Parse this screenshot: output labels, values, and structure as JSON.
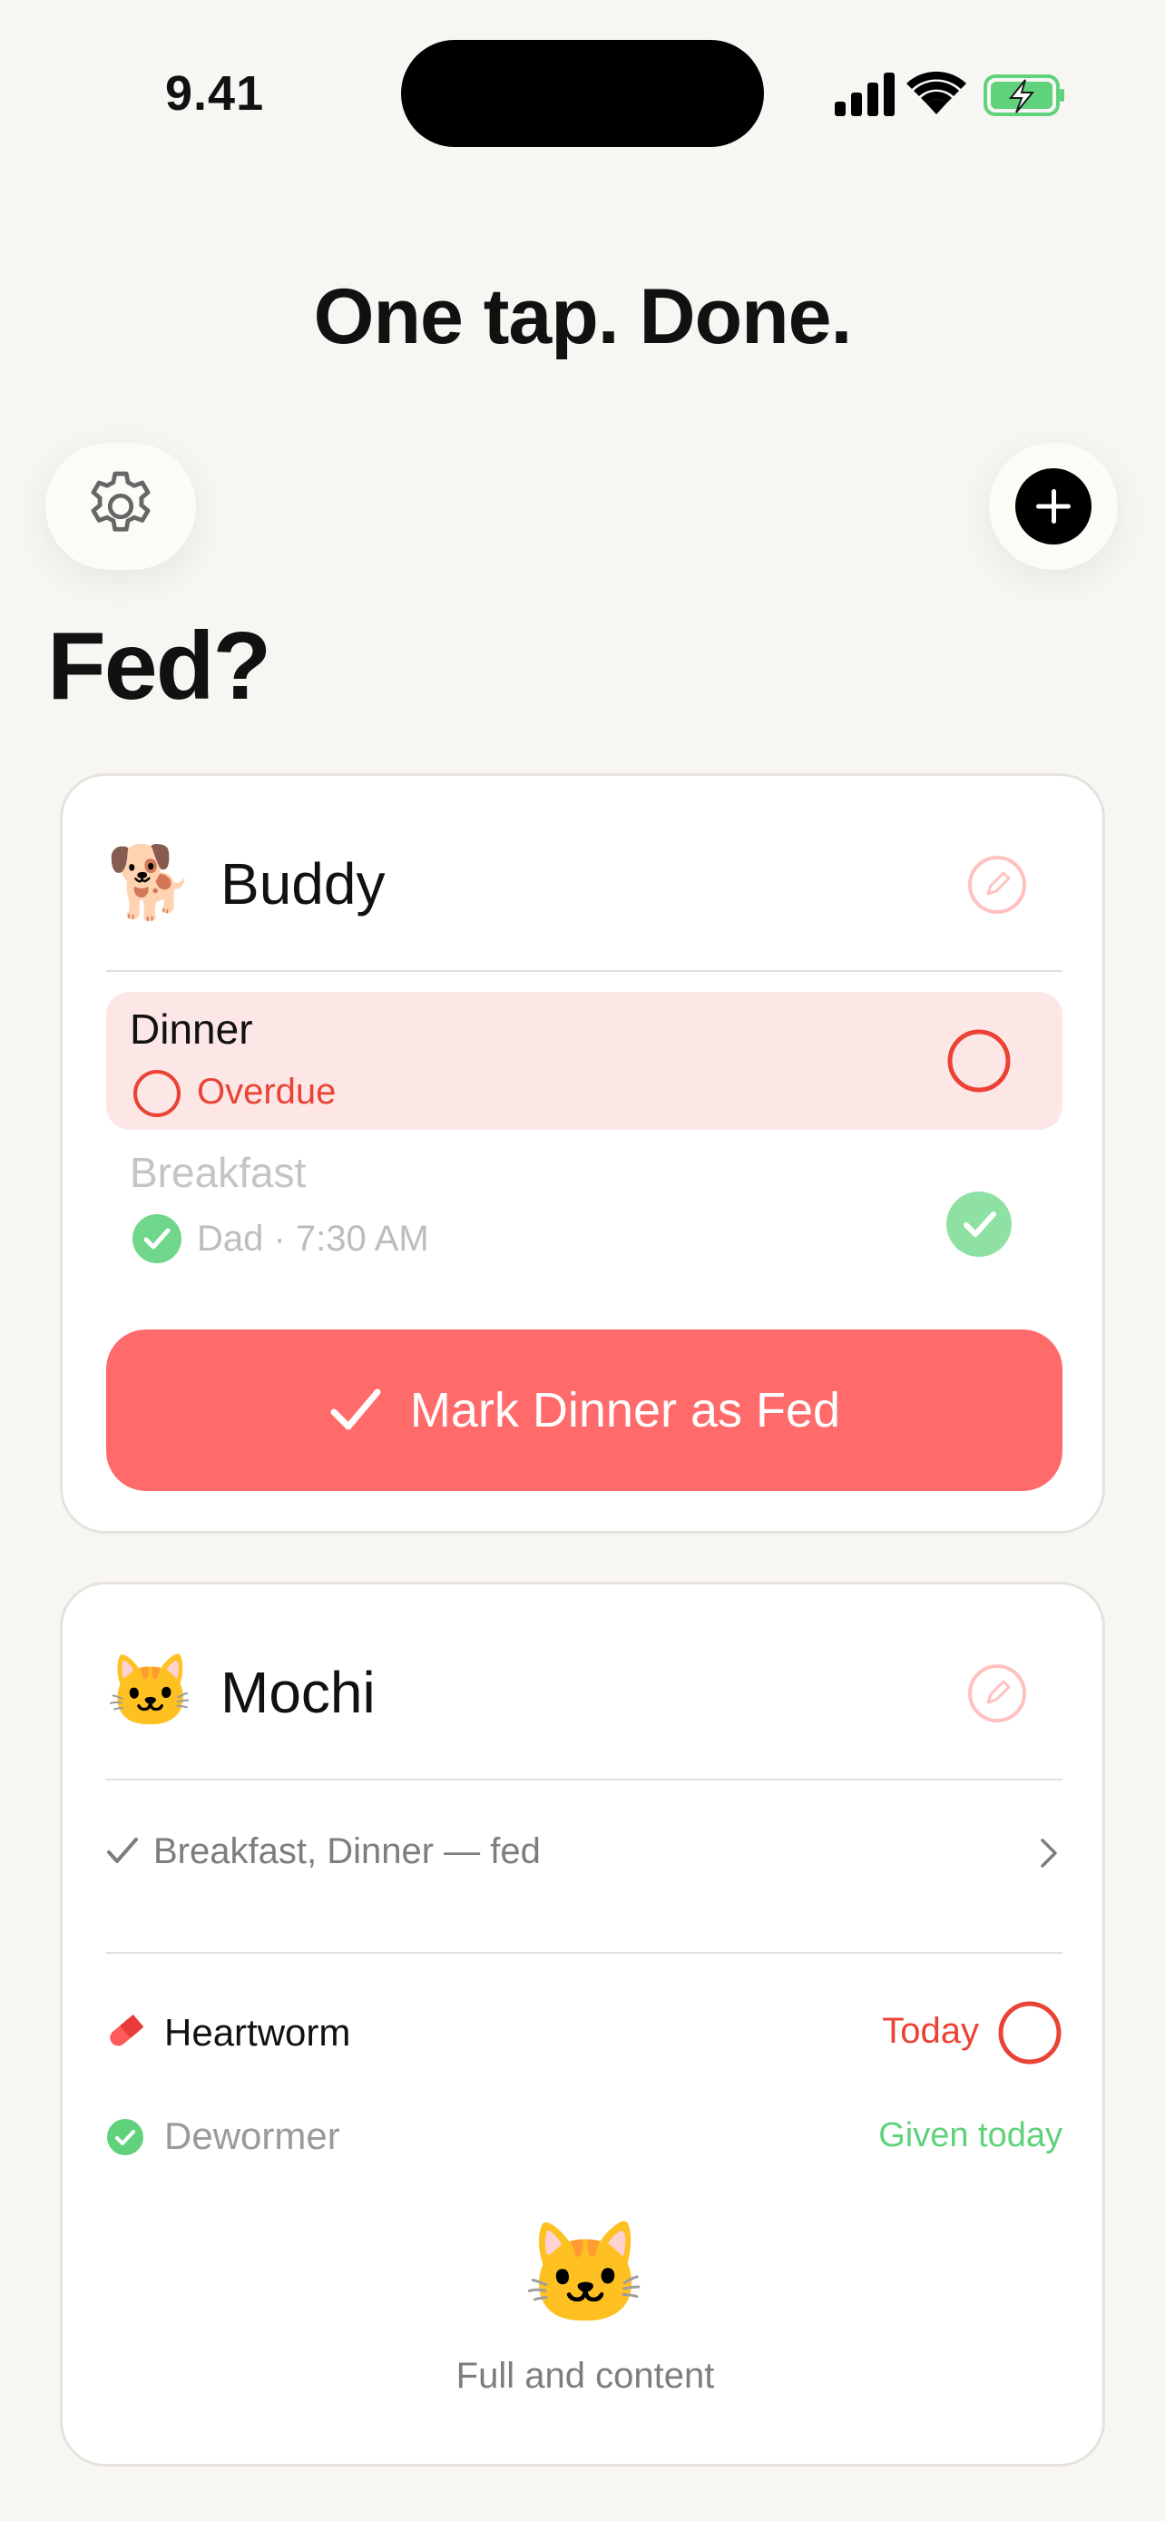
{
  "status_bar": {
    "time": "9.41"
  },
  "headline": "One tap. Done.",
  "page_title": "Fed?",
  "colors": {
    "accent_red": "#ff6b6b",
    "overdue_red": "#ea4335",
    "success_green": "#5fd27b",
    "background": "#f8f6f3"
  },
  "icons": {
    "settings": "gear-icon",
    "add": "plus-circle-icon",
    "edit": "pencil-icon"
  },
  "pets": [
    {
      "name": "Buddy",
      "emoji": "🐕",
      "meals": [
        {
          "name": "Dinner",
          "status": "Overdue"
        },
        {
          "name": "Breakfast",
          "status": "Dad · 7:30 AM"
        }
      ],
      "action_label": "Mark Dinner as Fed"
    },
    {
      "name": "Mochi",
      "emoji": "🐱",
      "summary": "Breakfast, Dinner — fed",
      "meds": [
        {
          "name": "Heartworm",
          "status": "Today"
        },
        {
          "name": "Dewormer",
          "status": "Given today"
        }
      ],
      "footer_emoji": "🐱",
      "footer_text": "Full and content"
    }
  ]
}
